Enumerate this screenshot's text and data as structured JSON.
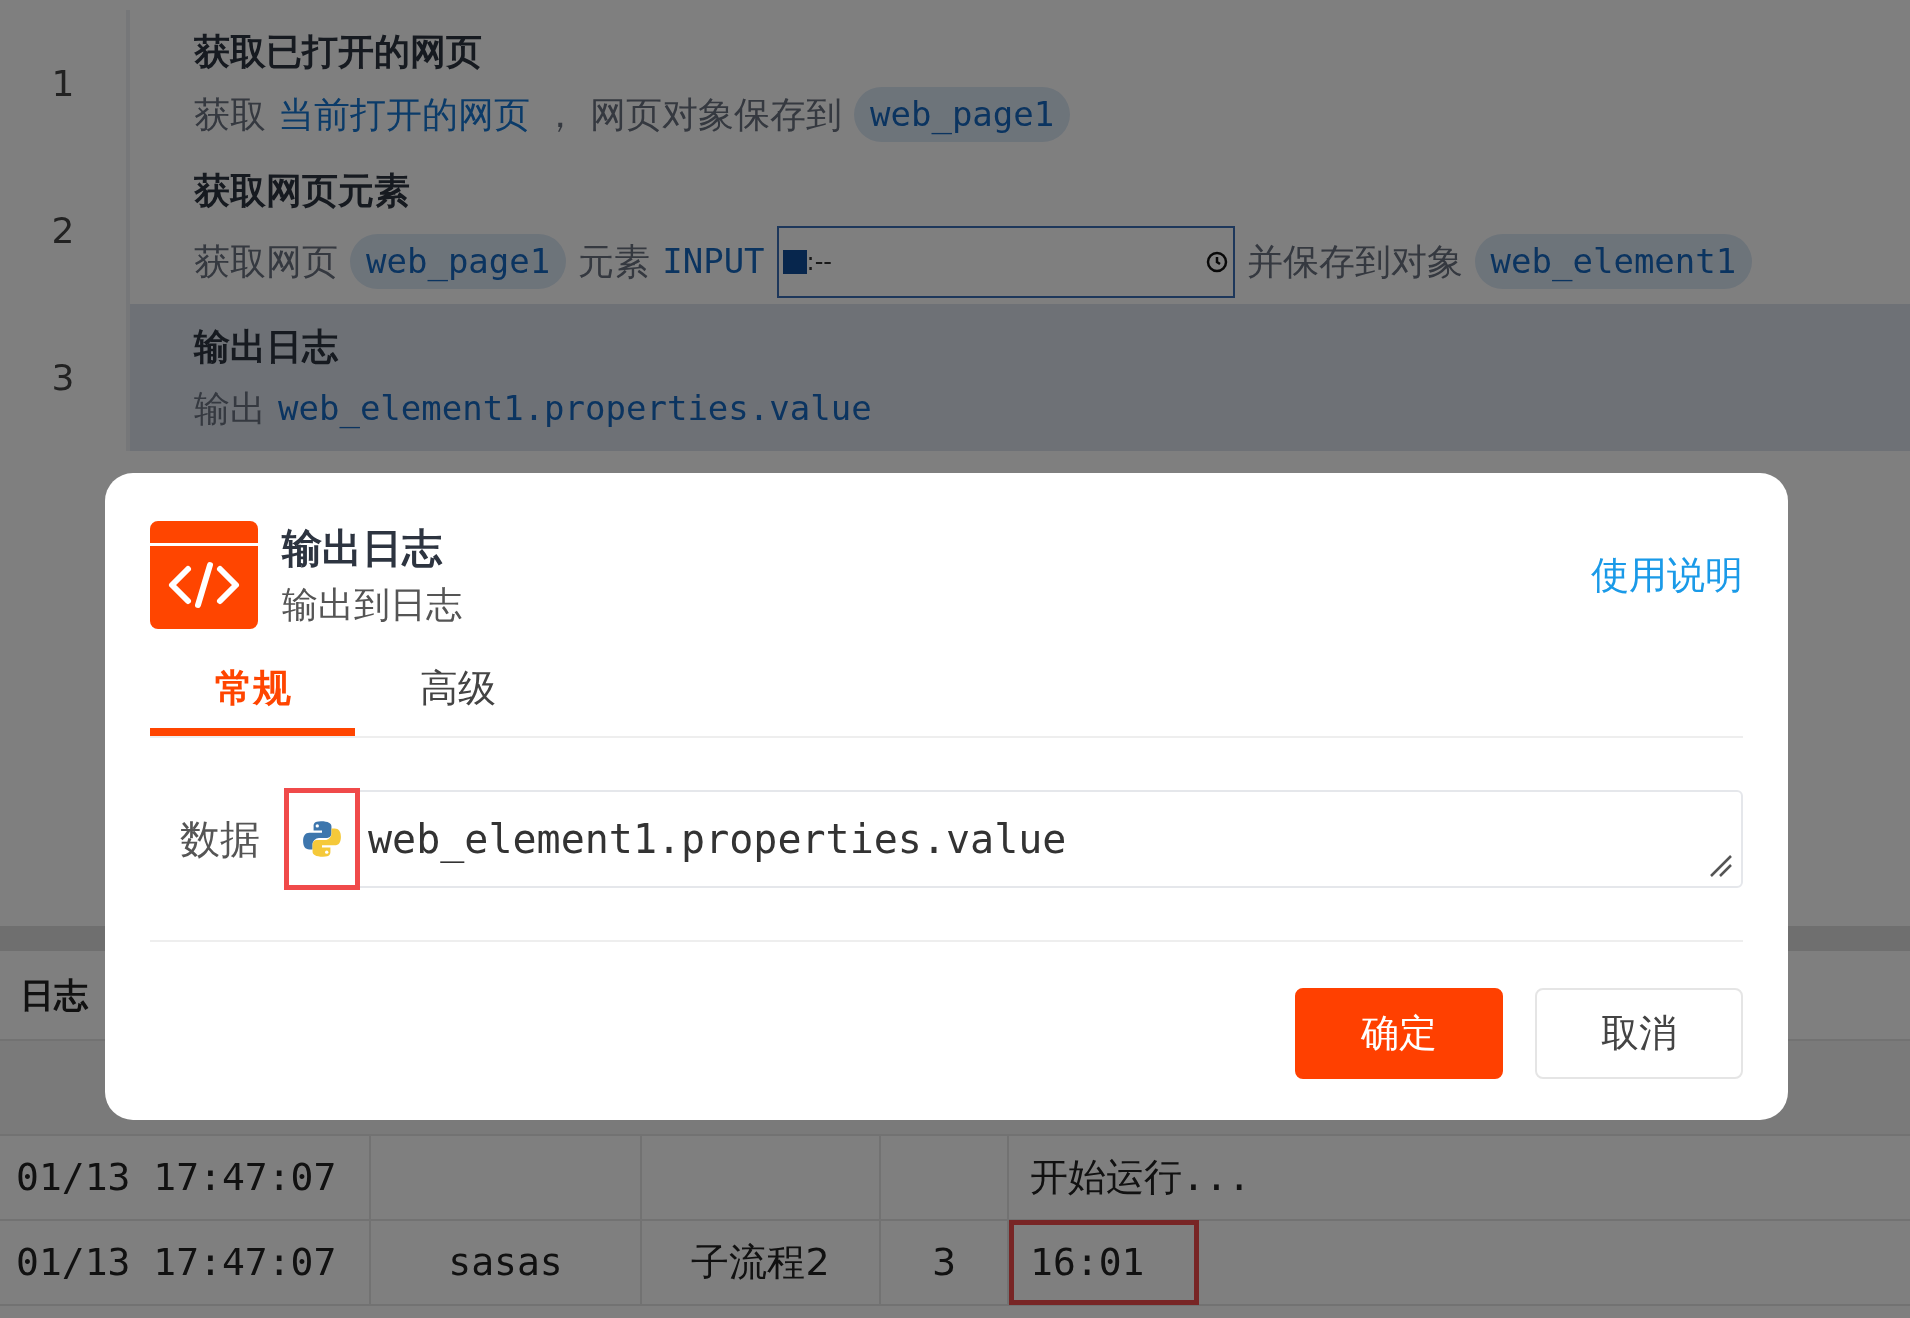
{
  "steps": [
    {
      "number": "1",
      "title": "获取已打开的网页",
      "selected": false,
      "parts": [
        {
          "kind": "text",
          "text": "获取"
        },
        {
          "kind": "link",
          "text": "当前打开的网页"
        },
        {
          "kind": "text",
          "text": "，"
        },
        {
          "kind": "text",
          "text": "网页对象保存到"
        },
        {
          "kind": "chip",
          "text": "web_page1"
        }
      ]
    },
    {
      "number": "2",
      "title": "获取网页元素",
      "selected": false,
      "parts": [
        {
          "kind": "text",
          "text": "获取网页"
        },
        {
          "kind": "chip",
          "text": "web_page1"
        },
        {
          "kind": "text",
          "text": "元素"
        },
        {
          "kind": "code",
          "text": "INPUT"
        },
        {
          "kind": "time",
          "text": ":--"
        },
        {
          "kind": "text",
          "text": "并保存到对象"
        },
        {
          "kind": "chip",
          "text": "web_element1"
        }
      ]
    },
    {
      "number": "3",
      "title": "输出日志",
      "selected": true,
      "parts": [
        {
          "kind": "text",
          "text": "输出"
        },
        {
          "kind": "code",
          "text": "web_element1.properties.value"
        }
      ]
    }
  ],
  "log": {
    "title": "日志",
    "rows": [
      {
        "time": "01/13 17:47:07",
        "message": "开始运行...",
        "message_marked": false
      },
      {
        "time": "01/13 17:47:07",
        "process": "sasas",
        "subflow": "子流程2",
        "line": "3",
        "message": "16:01",
        "message_marked": true
      }
    ]
  },
  "dialog": {
    "title": "输出日志",
    "subtitle": "输出到日志",
    "help_link": "使用说明",
    "tabs": [
      {
        "label": "常规",
        "selected": true
      },
      {
        "label": "高级",
        "selected": false
      }
    ],
    "field": {
      "label": "数据",
      "value": "web_element1.properties.value",
      "icon_marked": true
    },
    "buttons": [
      {
        "label": "确定",
        "kind": "primary"
      },
      {
        "label": "取消",
        "kind": "default"
      }
    ]
  }
}
